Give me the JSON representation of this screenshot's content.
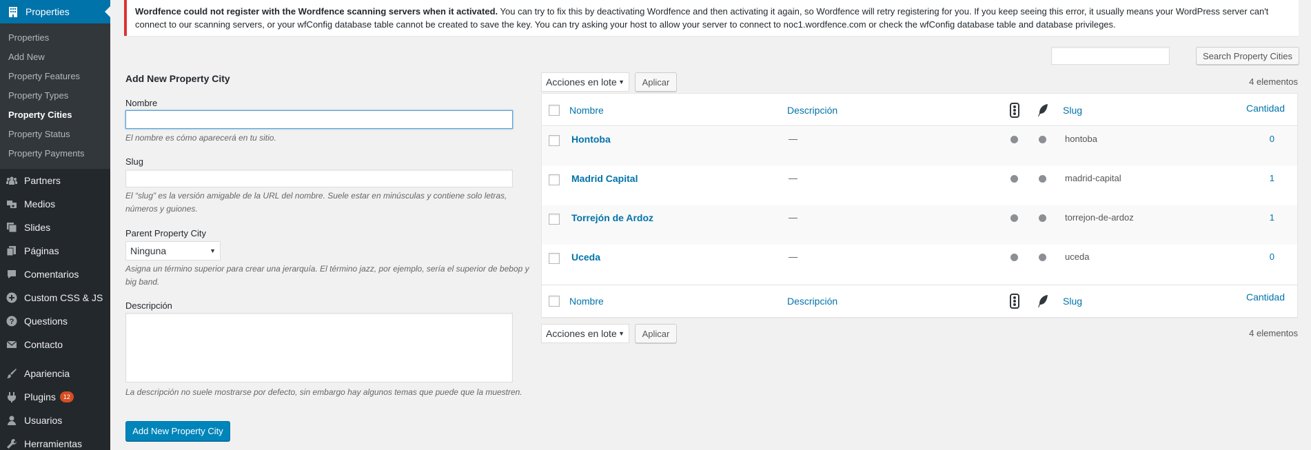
{
  "menu": {
    "current": {
      "label": "Properties",
      "icon": "building-icon"
    },
    "submenu": [
      {
        "label": "Properties"
      },
      {
        "label": "Add New"
      },
      {
        "label": "Property Features"
      },
      {
        "label": "Property Types"
      },
      {
        "label": "Property Cities",
        "current": true
      },
      {
        "label": "Property Status"
      },
      {
        "label": "Property Payments"
      }
    ],
    "items": [
      {
        "label": "Partners",
        "icon": "groups-icon"
      },
      {
        "label": "Medios",
        "icon": "media-icon"
      },
      {
        "label": "Slides",
        "icon": "slides-icon"
      },
      {
        "label": "Páginas",
        "icon": "pages-icon"
      },
      {
        "label": "Comentarios",
        "icon": "comments-icon"
      },
      {
        "label": "Custom CSS & JS",
        "icon": "plus-circle-icon"
      },
      {
        "label": "Questions",
        "icon": "question-icon"
      },
      {
        "label": "Contacto",
        "icon": "mail-icon"
      },
      {
        "label": "Apariencia",
        "icon": "brush-icon"
      },
      {
        "label": "Plugins",
        "icon": "plugin-icon",
        "badge": "12"
      },
      {
        "label": "Usuarios",
        "icon": "user-icon"
      },
      {
        "label": "Herramientas",
        "icon": "wrench-icon"
      }
    ]
  },
  "notice": {
    "bold": "Wordfence could not register with the Wordfence scanning servers when it activated.",
    "text": " You can try to fix this by deactivating Wordfence and then activating it again, so Wordfence will retry registering for you. If you keep seeing this error, it usually means your WordPress server can't connect to our scanning servers, or your wfConfig database table cannot be created to save the key. You can try asking your host to allow your server to connect to noc1.wordfence.com or check the wfConfig database table and database privileges."
  },
  "search": {
    "button": "Search Property Cities",
    "value": ""
  },
  "form": {
    "title": "Add New Property City",
    "name_label": "Nombre",
    "name_value": "",
    "name_help": "El nombre es cómo aparecerá en tu sitio.",
    "slug_label": "Slug",
    "slug_value": "",
    "slug_help": "El “slug” es la versión amigable de la URL del nombre. Suele estar en minúsculas y contiene solo letras, números y guiones.",
    "parent_label": "Parent Property City",
    "parent_selected": "Ninguna",
    "parent_help": "Asigna un término superior para crear una jerarquía. El término jazz, por ejemplo, sería el superior de bebop y big band.",
    "desc_label": "Descripción",
    "desc_value": "",
    "desc_help": "La descripción no suele mostrarse por defecto, sin embargo hay algunos temas que puede que la muestren.",
    "submit": "Add New Property City"
  },
  "bulk": {
    "selected": "Acciones en lote",
    "apply": "Aplicar",
    "count": "4 elementos"
  },
  "table": {
    "columns": {
      "name": "Nombre",
      "description": "Descripción",
      "slug": "Slug",
      "count": "Cantidad",
      "icon1": "traffic-light-icon",
      "icon2": "feather-icon"
    },
    "rows": [
      {
        "name": "Hontoba",
        "description": "—",
        "slug": "hontoba",
        "count": "0"
      },
      {
        "name": "Madrid Capital",
        "description": "—",
        "slug": "madrid-capital",
        "count": "1"
      },
      {
        "name": "Torrejón de Ardoz",
        "description": "—",
        "slug": "torrejon-de-ardoz",
        "count": "1"
      },
      {
        "name": "Uceda",
        "description": "—",
        "slug": "uceda",
        "count": "0"
      }
    ]
  }
}
